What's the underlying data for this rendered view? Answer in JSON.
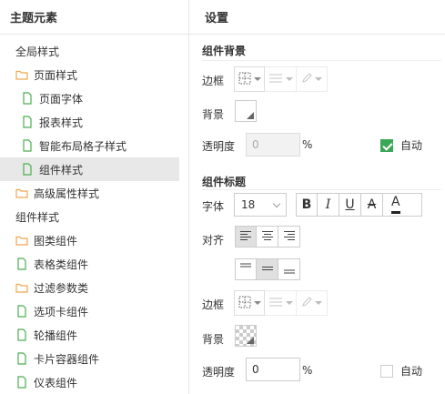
{
  "left_panel": {
    "title": "主题元素",
    "sections": [
      {
        "label": "全局样式",
        "type": "header"
      },
      {
        "label": "页面样式",
        "type": "folder"
      },
      {
        "label": "页面字体",
        "type": "file"
      },
      {
        "label": "报表样式",
        "type": "file"
      },
      {
        "label": "智能布局格子样式",
        "type": "file"
      },
      {
        "label": "组件样式",
        "type": "file",
        "selected": true
      },
      {
        "label": "高级属性样式",
        "type": "folder"
      },
      {
        "label": "组件样式",
        "type": "header"
      },
      {
        "label": "图类组件",
        "type": "folder"
      },
      {
        "label": "表格类组件",
        "type": "file"
      },
      {
        "label": "过滤参数类",
        "type": "folder"
      },
      {
        "label": "选项卡组件",
        "type": "file"
      },
      {
        "label": "轮播组件",
        "type": "file"
      },
      {
        "label": "卡片容器组件",
        "type": "file"
      },
      {
        "label": "仪表组件",
        "type": "file"
      }
    ]
  },
  "right_panel": {
    "title": "设置",
    "widget_bg": {
      "title": "组件背景",
      "border_label": "边框",
      "bg_label": "背景",
      "opacity_label": "透明度",
      "opacity_value": "0",
      "opacity_unit": "%",
      "auto_label": "自动",
      "auto_checked": true
    },
    "widget_title": {
      "title": "组件标题",
      "font_label": "字体",
      "font_size": "18",
      "bold": "B",
      "italic": "I",
      "underline": "U",
      "strike": "A",
      "color_letter": "A",
      "align_label": "对齐",
      "border_label": "边框",
      "bg_label": "背景",
      "opacity_label": "透明度",
      "opacity_value": "0",
      "opacity_unit": "%",
      "auto_label": "自动",
      "auto_checked": false
    }
  },
  "colors": {
    "folder": "#f0a84f",
    "file": "#4caf50",
    "check": "#3aa757",
    "font_color_bar": "#222222"
  }
}
